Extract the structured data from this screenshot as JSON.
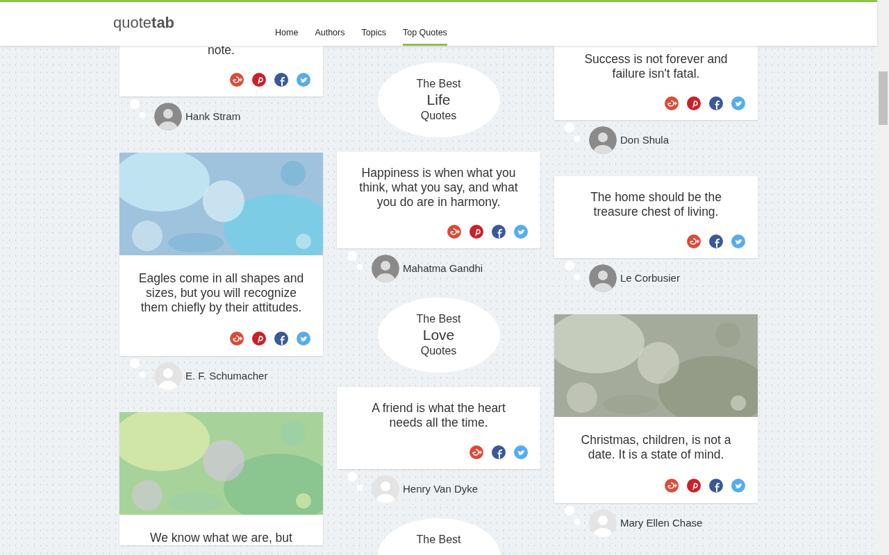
{
  "header": {
    "logo": "quote**tab**",
    "nav": [
      {
        "label": "Home",
        "selected": false
      },
      {
        "label": "Authors",
        "selected": false
      },
      {
        "label": "Topics",
        "selected": false
      },
      {
        "label": "Top Quotes",
        "selected": true
      }
    ]
  },
  "columns": [
    [
      {
        "kind": "quote",
        "text": "note.",
        "shares": [
          {
            "kind": "gplus"
          },
          {
            "kind": "pinterest"
          },
          {
            "kind": "facebook"
          },
          {
            "kind": "twitter"
          }
        ]
      },
      {
        "kind": "author",
        "name": "Hank Stram",
        "photo": true
      },
      {
        "kind": "quote",
        "image": {
          "kind": "picture"
        },
        "text": "Eagles come in all shapes and sizes, but you will recognize them chiefly by their attitudes.",
        "shares": [
          {
            "kind": "gplus"
          },
          {
            "kind": "pinterest"
          },
          {
            "kind": "facebook"
          },
          {
            "kind": "twitter"
          }
        ]
      },
      {
        "kind": "author",
        "name": "E. F. Schumacher",
        "photo": false
      },
      {
        "kind": "quote",
        "image": {
          "kind": "picture"
        },
        "text": "We know what we are, but"
      }
    ],
    [
      {
        "kind": "topic",
        "lines": [
          "The Best",
          "Life",
          "Quotes"
        ]
      },
      {
        "kind": "quote",
        "text": "Happiness is when what you think, what you say, and what you do are in harmony.",
        "shares": [
          {
            "kind": "gplus"
          },
          {
            "kind": "pinterest"
          },
          {
            "kind": "facebook"
          },
          {
            "kind": "twitter"
          }
        ]
      },
      {
        "kind": "author",
        "name": "Mahatma Gandhi",
        "photo": true
      },
      {
        "kind": "topic",
        "lines": [
          "The Best",
          "Love",
          "Quotes"
        ]
      },
      {
        "kind": "quote",
        "text": "A friend is what the heart needs all the time.",
        "shares": [
          {
            "kind": "gplus"
          },
          {
            "kind": "facebook"
          },
          {
            "kind": "twitter"
          }
        ]
      },
      {
        "kind": "author",
        "name": "Henry Van Dyke",
        "photo": false
      },
      {
        "kind": "topic",
        "lines": [
          "The Best"
        ]
      }
    ],
    [
      {
        "kind": "quote",
        "text": "Success is not forever and failure isn't fatal.",
        "shares": [
          {
            "kind": "gplus"
          },
          {
            "kind": "pinterest"
          },
          {
            "kind": "facebook"
          },
          {
            "kind": "twitter"
          }
        ]
      },
      {
        "kind": "author",
        "name": "Don Shula",
        "photo": true
      },
      {
        "kind": "quote",
        "text": "The home should be the treasure chest of living.",
        "shares": [
          {
            "kind": "gplus"
          },
          {
            "kind": "facebook"
          },
          {
            "kind": "twitter"
          }
        ]
      },
      {
        "kind": "author",
        "name": "Le Corbusier",
        "photo": true
      },
      {
        "kind": "quote",
        "image": {
          "kind": "picture"
        },
        "text": "Christmas, children, is not a date. It is a state of mind.",
        "shares": [
          {
            "kind": "gplus"
          },
          {
            "kind": "pinterest"
          },
          {
            "kind": "facebook"
          },
          {
            "kind": "twitter"
          }
        ]
      },
      {
        "kind": "author",
        "name": "Mary Ellen Chase",
        "photo": false
      }
    ]
  ]
}
